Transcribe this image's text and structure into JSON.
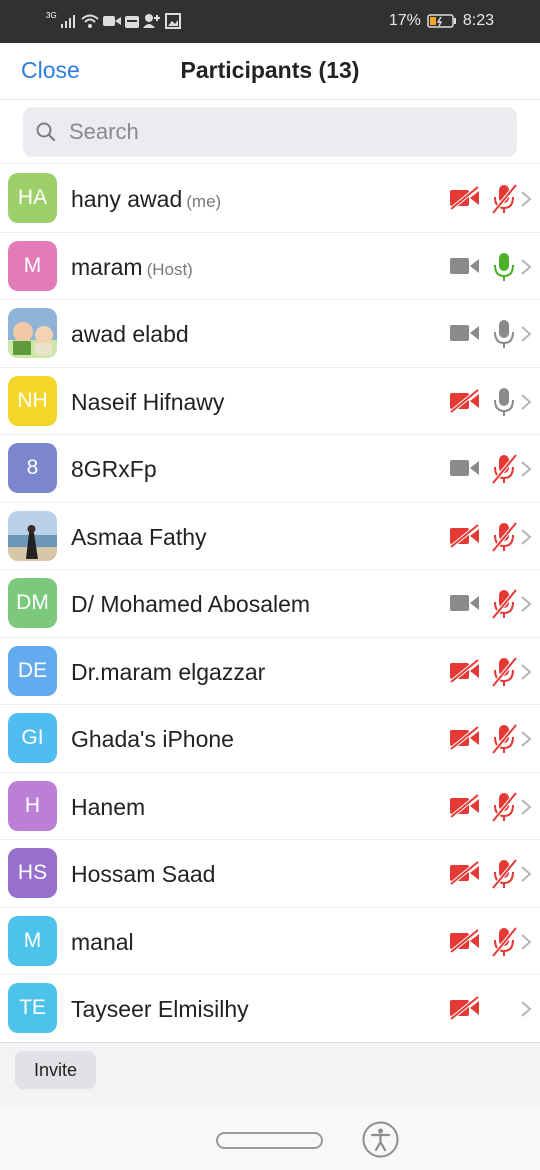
{
  "status_bar": {
    "network": "3G",
    "battery": "17%",
    "time": "8:23"
  },
  "header": {
    "close_label": "Close",
    "title": "Participants (13)"
  },
  "search": {
    "placeholder": "Search"
  },
  "participants": [
    {
      "initials": "HA",
      "name": "hany awad",
      "tag": "(me)",
      "avatar_color": "#9ed06a",
      "video": "off",
      "audio": "muted"
    },
    {
      "initials": "M",
      "name": "maram",
      "tag": "(Host)",
      "avatar_color": "#e57ab8",
      "video": "on",
      "audio": "speaking"
    },
    {
      "initials": "",
      "name": "awad elabd",
      "tag": "",
      "avatar_photo": "baby-photo",
      "video": "on",
      "audio": "on"
    },
    {
      "initials": "NH",
      "name": "Naseif Hifnawy",
      "tag": "",
      "avatar_color": "#f3d629",
      "video": "off",
      "audio": "on"
    },
    {
      "initials": "8",
      "name": "8GRxFp",
      "tag": "",
      "avatar_color": "#7b86cf",
      "video": "on",
      "audio": "muted"
    },
    {
      "initials": "",
      "name": "Asmaa Fathy",
      "tag": "",
      "avatar_photo": "beach-photo",
      "video": "off",
      "audio": "muted"
    },
    {
      "initials": "DM",
      "name": "D/ Mohamed Abosalem",
      "tag": "",
      "avatar_color": "#7cc97d",
      "video": "on",
      "audio": "muted"
    },
    {
      "initials": "DE",
      "name": "Dr.maram elgazzar",
      "tag": "",
      "avatar_color": "#63abef",
      "video": "off",
      "audio": "muted"
    },
    {
      "initials": "GI",
      "name": "Ghada's iPhone",
      "tag": "",
      "avatar_color": "#4fbdf0",
      "video": "off",
      "audio": "muted"
    },
    {
      "initials": "H",
      "name": "Hanem",
      "tag": "",
      "avatar_color": "#bd7ed6",
      "video": "off",
      "audio": "muted"
    },
    {
      "initials": "HS",
      "name": "Hossam Saad",
      "tag": "",
      "avatar_color": "#9670cc",
      "video": "off",
      "audio": "muted"
    },
    {
      "initials": "M",
      "name": "manal",
      "tag": "",
      "avatar_color": "#4dc3ec",
      "video": "off",
      "audio": "muted"
    },
    {
      "initials": "TE",
      "name": "Tayseer Elmisilhy",
      "tag": "",
      "avatar_color": "#4dc3ec",
      "video": "off",
      "audio": "none"
    }
  ],
  "bottom": {
    "invite_label": "Invite"
  },
  "colors": {
    "accent": "#2d7de0",
    "muted_red": "#e53935",
    "speaking_green": "#4caf2a",
    "icon_gray": "#8a8a8a"
  }
}
